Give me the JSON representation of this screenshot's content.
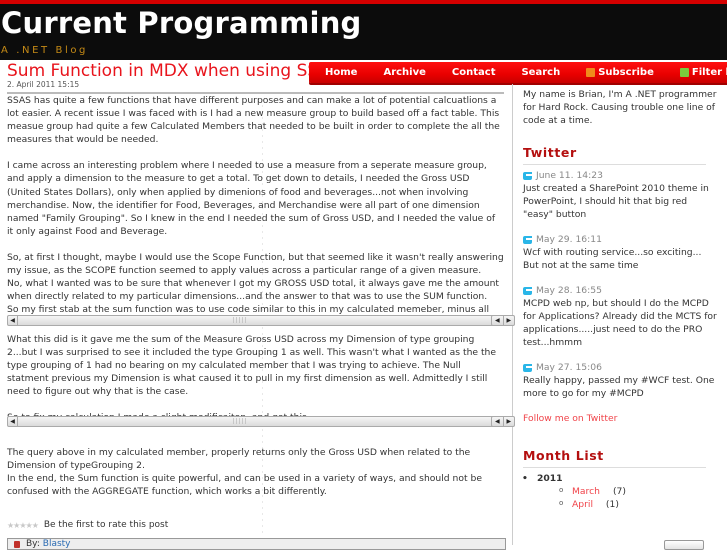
{
  "header": {
    "site_title": "Current Programming",
    "tagline": "A .NET Blog"
  },
  "nav": {
    "items": [
      {
        "label": "Home",
        "icon": null
      },
      {
        "label": "Archive",
        "icon": null
      },
      {
        "label": "Contact",
        "icon": null
      },
      {
        "label": "Search",
        "icon": null
      },
      {
        "label": "Subscribe",
        "icon": "rss-icon"
      },
      {
        "label": "Filter by APML",
        "icon": "apml-icon"
      }
    ]
  },
  "post": {
    "title": "Sum Function in MDX when using SSAS",
    "date": "2. April 2011 15:15",
    "paragraphs": [
      "SSAS has quite a few functions that have different purposes and can make a lot of potential calcuatlions a lot easier.  A recent issue I was faced with is I had a new measure group to build based off a fact table.  This measue group had quite a few Calculated Members that needed to be built in order to complete the all the measures that would be needed.",
      "I came across an interesting problem where I needed to use a measure from a seperate measure group, and apply a dimension to the measure to get a total. To get down to details, I needed the Gross USD (United States Dollars), only when applied by dimenions of food and beverages...not when involving merchandise.   Now, the identifier for Food, Beverages, and Merchandise were all part of one dimension named \"Family Grouping\".  So I knew in the end I needed the sum of Gross USD, and I needed the value of it only against Food and Beverage.",
      "So, at first I thought, maybe I would use the Scope Function, but that seemed like it wasn't really answering my issue, as the SCOPE function seemed to apply values across a particular range of a given measure.",
      "No, what I wanted was to be sure that whenever I got my GROSS USD total, it always gave me the amount when directly related to my particular dimensions...and the answer to that was to use the SUM function.",
      "So my first stab at the sum function was to use code similar to this in my calculated memeber, minus all the other \"who-ha\".",
      "What this did is it gave me the sum of the Measure Gross USD across my Dimension of type grouping 2...but I was surprised to see it included the type Grouping 1 as well.  This wasn't what I wanted as the the type grouping of 1 had no bearing on my calculated member that I was trying to achieve.  The Null statment previous my Dimension is what caused it to pull in my first dimension as well.  Admittedly I still need to figure out why that is the case.",
      "So to fix my calculation I made a slight modificaiton, and got this.",
      "The query above in my calculated member, properly returns only the Gross USD when related to the Dimension of typeGrouping 2.",
      "In the end, the Sum function is quite powerful, and can be used in a variety of ways, and should not be confused with the AGGREGATE function, which works a bit differently."
    ],
    "rating_text": "Be the first to rate this post",
    "rating_value": 0,
    "rating_max": 5,
    "author_prefix": "By:",
    "author_name": "Blasty"
  },
  "sidebar": {
    "about": "My name is Brian, I'm A .NET programmer for Hard Rock. Causing trouble one line of code at a time.",
    "twitter": {
      "title": "Twitter",
      "tweets": [
        {
          "date": "June 11. 14:23",
          "text": "Just created a SharePoint 2010 theme in PowerPoint, I should hit that big red \"easy\" button"
        },
        {
          "date": "May 29. 16:11",
          "text": "Wcf with routing service...so exciting... But not at the same time"
        },
        {
          "date": "May 28. 16:55",
          "text": "MCPD web np, but should I do the MCPD for Applications? Already did the MCTS for applications.....just need to do the PRO test...hmmm"
        },
        {
          "date": "May 27. 15:06",
          "text": "Really happy, passed my #WCF test. One more to go for my #MCPD"
        }
      ],
      "follow_link": "Follow me on Twitter"
    },
    "month_list": {
      "title": "Month List",
      "years": [
        {
          "year": "2011",
          "months": [
            {
              "name": "March",
              "count": "(7)"
            },
            {
              "name": "April",
              "count": "(1)"
            }
          ]
        }
      ]
    }
  },
  "colors": {
    "accent_red": "#e8141c",
    "nav_red": "#e80000",
    "widget_title": "#b40f0f",
    "tagline": "#c58a16",
    "link": "#f0444a"
  }
}
